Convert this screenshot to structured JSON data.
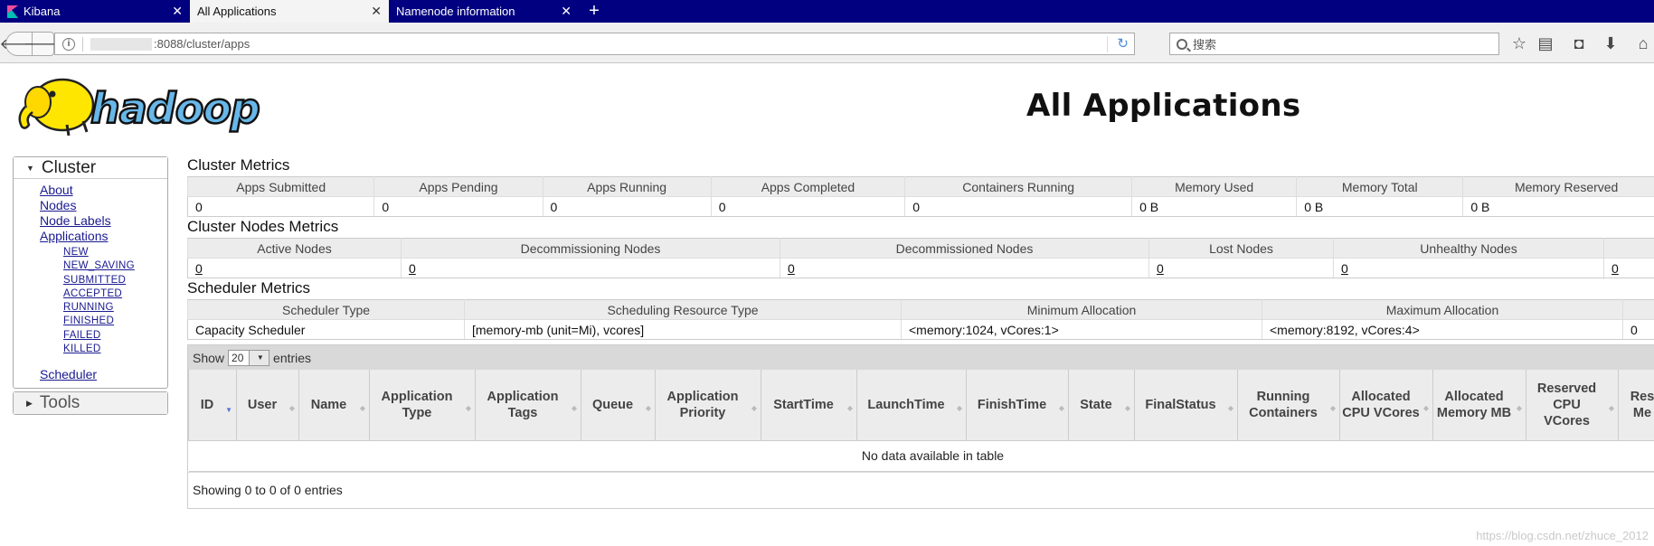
{
  "browser": {
    "tabs": [
      {
        "label": "Kibana",
        "active": false
      },
      {
        "label": "All Applications",
        "active": true
      },
      {
        "label": "Namenode information",
        "active": false
      }
    ],
    "new_tab": "+",
    "url": ":8088/cluster/apps",
    "search_placeholder": "搜索"
  },
  "page": {
    "title": "All Applications",
    "logo_text": "hadoop"
  },
  "nav": {
    "cluster_label": "Cluster",
    "items": [
      {
        "label": "About"
      },
      {
        "label": "Nodes"
      },
      {
        "label": "Node Labels"
      },
      {
        "label": "Applications"
      }
    ],
    "app_states": [
      "NEW",
      "NEW_SAVING",
      "SUBMITTED",
      "ACCEPTED",
      "RUNNING",
      "FINISHED",
      "FAILED",
      "KILLED"
    ],
    "scheduler_label": "Scheduler",
    "tools_label": "Tools"
  },
  "cluster_metrics": {
    "title": "Cluster Metrics",
    "headers": [
      "Apps Submitted",
      "Apps Pending",
      "Apps Running",
      "Apps Completed",
      "Containers Running",
      "Memory Used",
      "Memory Total",
      "Memory Reserved"
    ],
    "values": [
      "0",
      "0",
      "0",
      "0",
      "0",
      "0 B",
      "0 B",
      "0 B"
    ]
  },
  "node_metrics": {
    "title": "Cluster Nodes Metrics",
    "headers": [
      "Active Nodes",
      "Decommissioning Nodes",
      "Decommissioned Nodes",
      "Lost Nodes",
      "Unhealthy Nodes",
      ""
    ],
    "values": [
      "0",
      "0",
      "0",
      "0",
      "0",
      "0"
    ]
  },
  "scheduler_metrics": {
    "title": "Scheduler Metrics",
    "headers": [
      "Scheduler Type",
      "Scheduling Resource Type",
      "Minimum Allocation",
      "Maximum Allocation",
      ""
    ],
    "values": [
      "Capacity Scheduler",
      "[memory-mb (unit=Mi), vcores]",
      "<memory:1024, vCores:1>",
      "<memory:8192, vCores:4>",
      "0"
    ]
  },
  "apps_table": {
    "show_label": "Show",
    "page_length": "20",
    "entries_label": "entries",
    "columns": [
      "ID",
      "User",
      "Name",
      "Application Type",
      "Application Tags",
      "Queue",
      "Application Priority",
      "StartTime",
      "LaunchTime",
      "FinishTime",
      "State",
      "FinalStatus",
      "Running Containers",
      "Allocated CPU VCores",
      "Allocated Memory MB",
      "Reserved CPU VCores",
      "Res Me"
    ],
    "empty_message": "No data available in table",
    "info": "Showing 0 to 0 of 0 entries"
  },
  "watermark": "https://blog.csdn.net/zhuce_2012"
}
